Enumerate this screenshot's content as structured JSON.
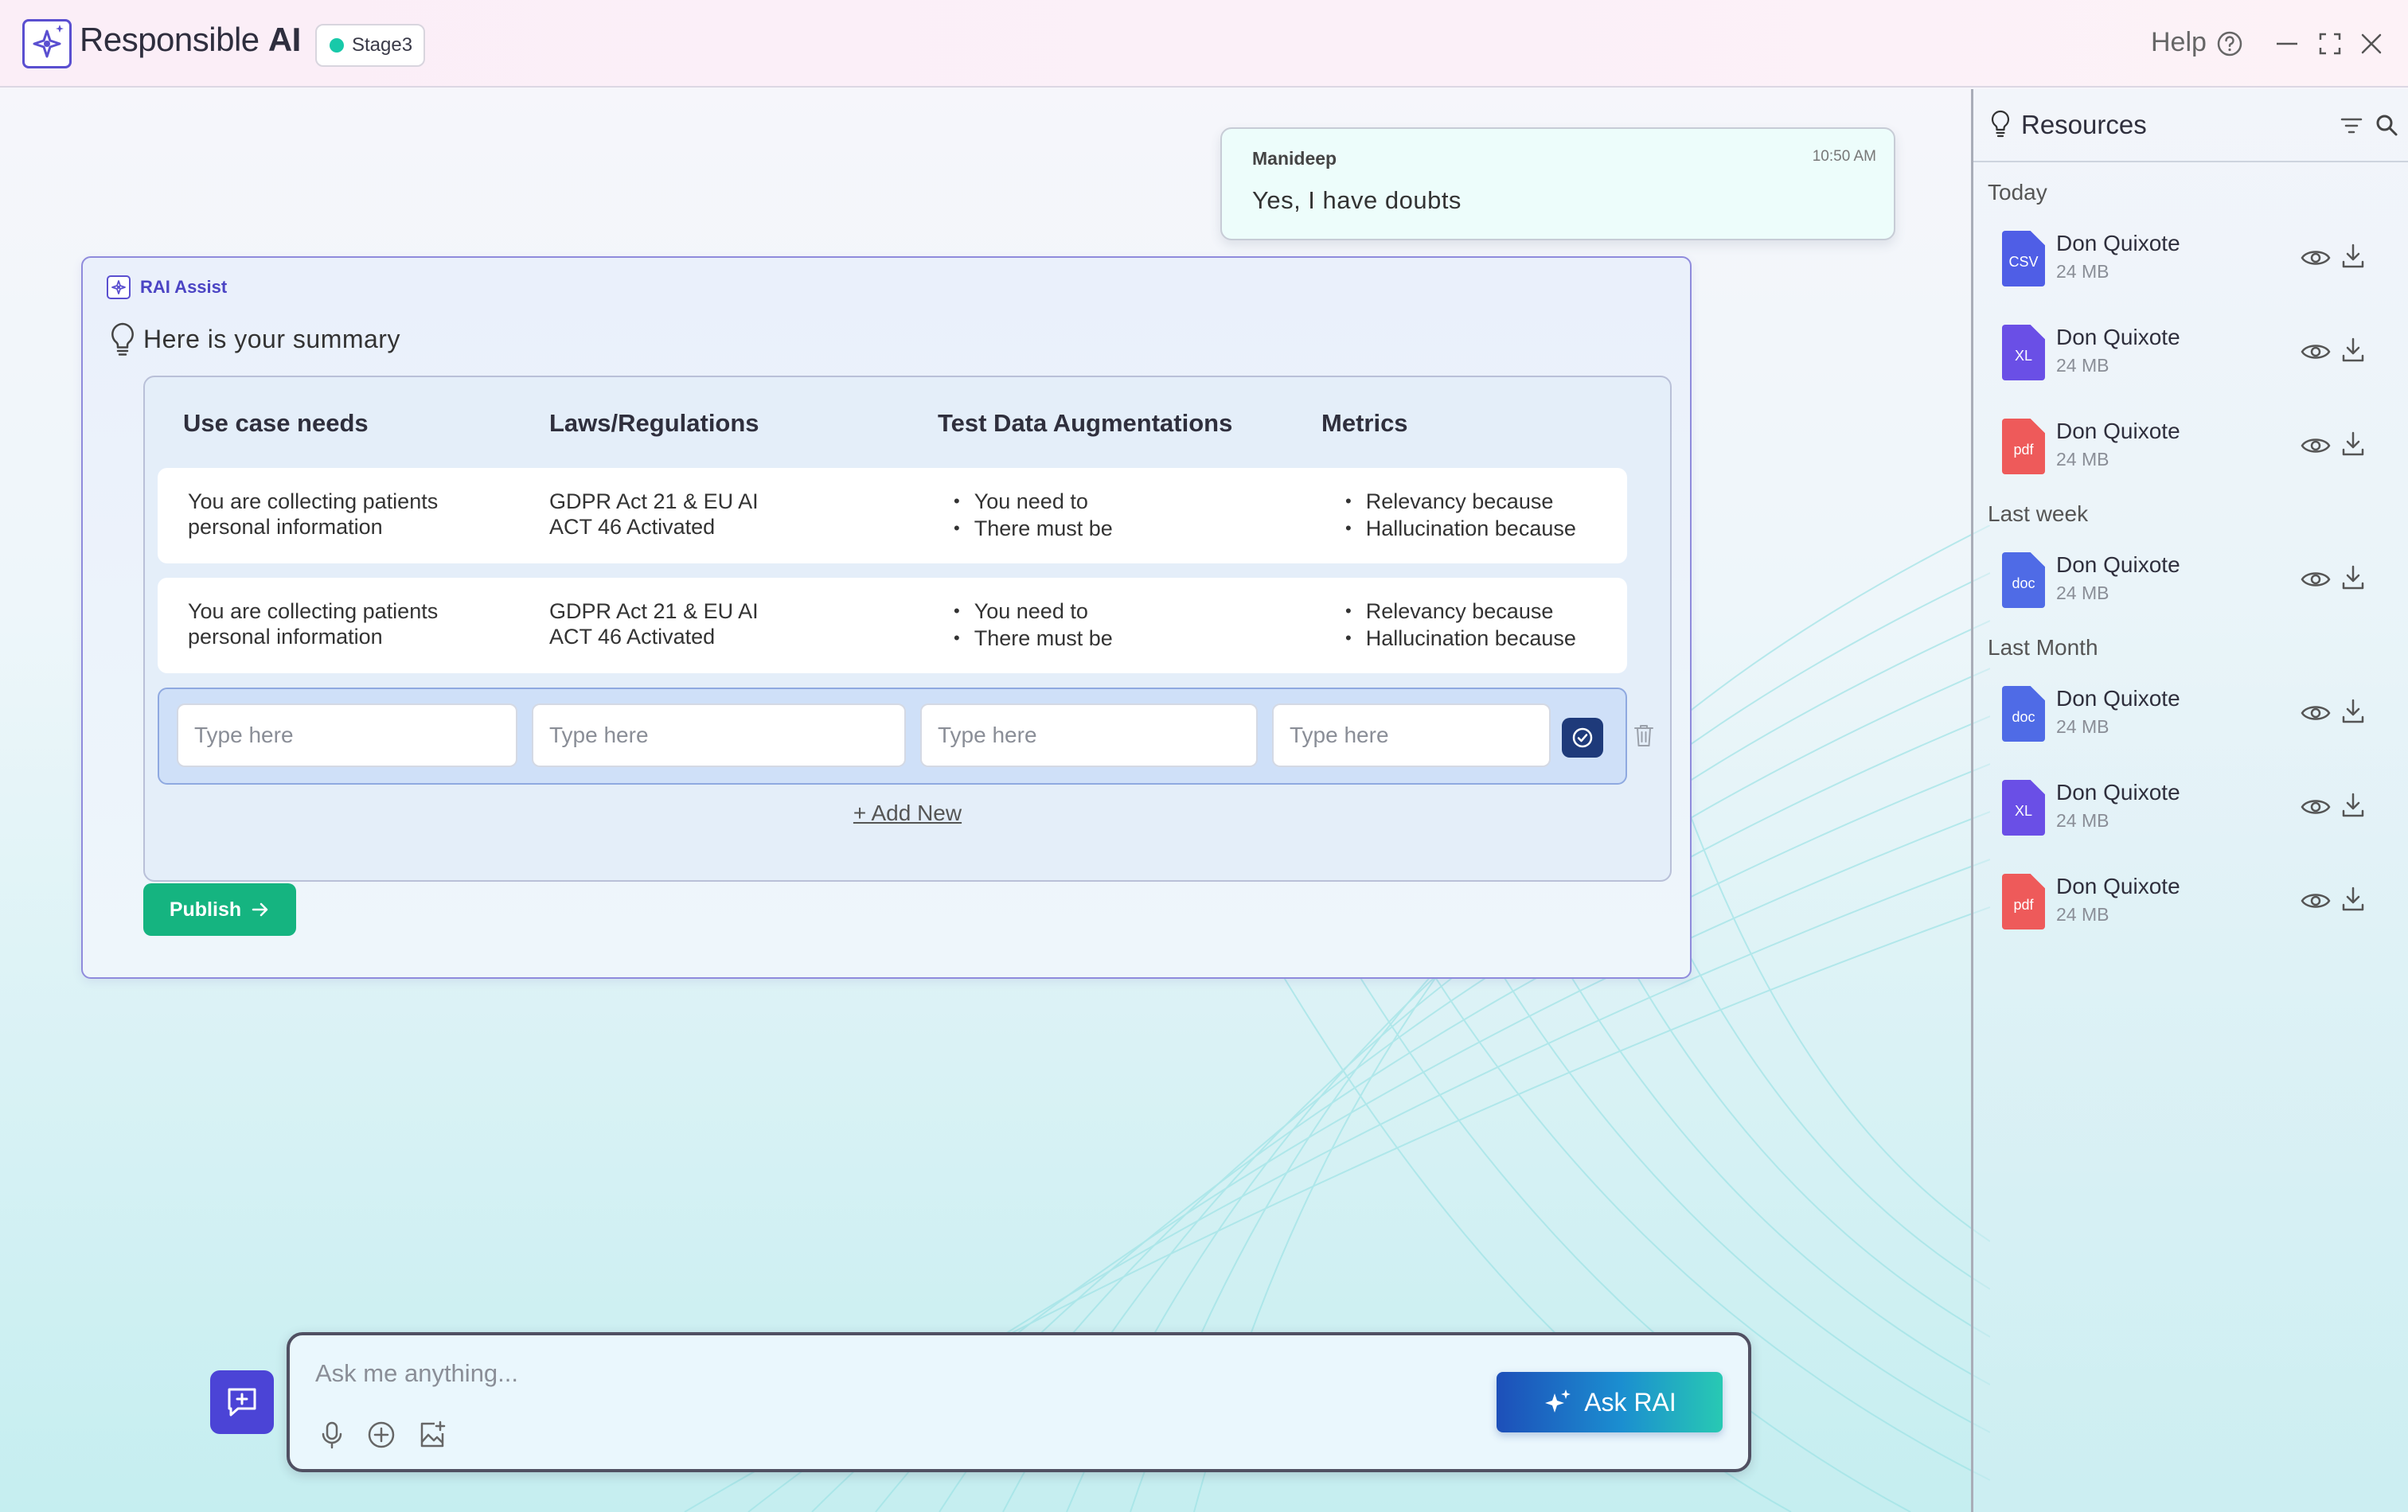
{
  "header": {
    "app_title_light": "Responsible",
    "app_title_bold": "AI",
    "stage_badge": "Stage3",
    "help_label": "Help",
    "colors": {
      "brand": "#5a4fd0",
      "stage_dot": "#18c9a9"
    }
  },
  "chat": {
    "user_message": {
      "author": "Manideep",
      "time": "10:50 AM",
      "text": "Yes, I have doubts"
    },
    "assistant": {
      "label": "RAI Assist",
      "summary_title": "Here is your summary",
      "table": {
        "headers": [
          "Use case needs",
          "Laws/Regulations",
          "Test Data Augmentations",
          "Metrics"
        ],
        "rows": [
          {
            "use_case": [
              "You are collecting patients",
              "personal information"
            ],
            "laws": [
              "GDPR Act 21 & EU AI",
              "ACT 46 Activated"
            ],
            "augmentations": [
              "You need to",
              "There must be"
            ],
            "metrics": [
              "Relevancy because",
              "Hallucination because"
            ]
          },
          {
            "use_case": [
              "You are collecting patients",
              "personal information"
            ],
            "laws": [
              "GDPR Act 21 & EU AI",
              "ACT 46 Activated"
            ],
            "augmentations": [
              "You need to",
              "There must be"
            ],
            "metrics": [
              "Relevancy because",
              "Hallucination because"
            ]
          }
        ],
        "edit_row_placeholders": [
          "Type here",
          "Type here",
          "Type here",
          "Type here"
        ],
        "add_new_label": "+ Add New"
      },
      "publish_label": "Publish"
    }
  },
  "composer": {
    "placeholder": "Ask me anything...",
    "ask_button_label": "Ask RAI"
  },
  "resources": {
    "title": "Resources",
    "groups": [
      {
        "label": "Today",
        "files": [
          {
            "name": "Don Quixote",
            "size": "24 MB",
            "type": "CSV",
            "color": "#4f5ee6"
          },
          {
            "name": "Don Quixote",
            "size": "24 MB",
            "type": "XL",
            "color": "#6a4fe6"
          },
          {
            "name": "Don Quixote",
            "size": "24 MB",
            "type": "pdf",
            "color": "#ee5a5a"
          }
        ]
      },
      {
        "label": "Last week",
        "files": [
          {
            "name": "Don Quixote",
            "size": "24 MB",
            "type": "doc",
            "color": "#4f6be6"
          }
        ]
      },
      {
        "label": "Last Month",
        "files": [
          {
            "name": "Don Quixote",
            "size": "24 MB",
            "type": "doc",
            "color": "#4f6be6"
          },
          {
            "name": "Don Quixote",
            "size": "24 MB",
            "type": "XL",
            "color": "#6a4fe6"
          },
          {
            "name": "Don Quixote",
            "size": "24 MB",
            "type": "pdf",
            "color": "#ee5a5a"
          }
        ]
      }
    ]
  }
}
